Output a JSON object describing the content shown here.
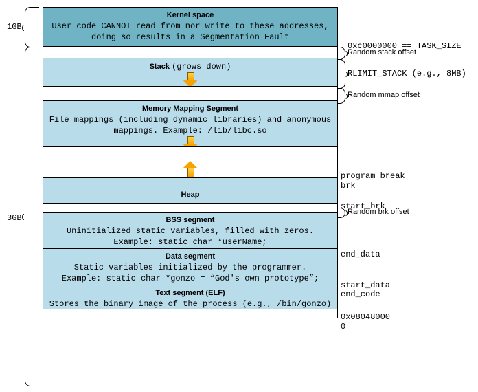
{
  "left": {
    "top_size": "1GB",
    "bottom_size": "3GB"
  },
  "segments": {
    "kernel": {
      "title": "Kernel space",
      "desc": "User code CANNOT read from nor write to these addresses, doing so results in a Segmentation Fault"
    },
    "stack": {
      "title": "Stack",
      "note": "(grows down)"
    },
    "mmap": {
      "title": "Memory Mapping Segment",
      "desc": "File mappings (including dynamic libraries) and anonymous mappings. Example: /lib/libc.so"
    },
    "heap": {
      "title": "Heap"
    },
    "bss": {
      "title": "BSS segment",
      "desc1": "Uninitialized static variables, filled with zeros.",
      "desc2": "Example: static char *userName;"
    },
    "data": {
      "title": "Data segment",
      "desc1": "Static variables initialized by the programmer.",
      "desc2": "Example: static char *gonzo = “God's own prototype”;"
    },
    "text": {
      "title": "Text segment (ELF)",
      "desc": "Stores the binary image of the process (e.g., /bin/gonzo)"
    }
  },
  "right": {
    "task_size": "0xc0000000 == TASK_SIZE",
    "rand_stack": "Random stack offset",
    "rlimit": "RLIMIT_STACK (e.g., 8MB)",
    "rand_mmap": "Random mmap offset",
    "program_break": "program break",
    "brk": "brk",
    "start_brk": "start_brk",
    "rand_brk": "Random brk offset",
    "end_data": "end_data",
    "start_data": "start_data",
    "end_code": "end_code",
    "addr_text": "0x08048000",
    "zero": "0"
  }
}
